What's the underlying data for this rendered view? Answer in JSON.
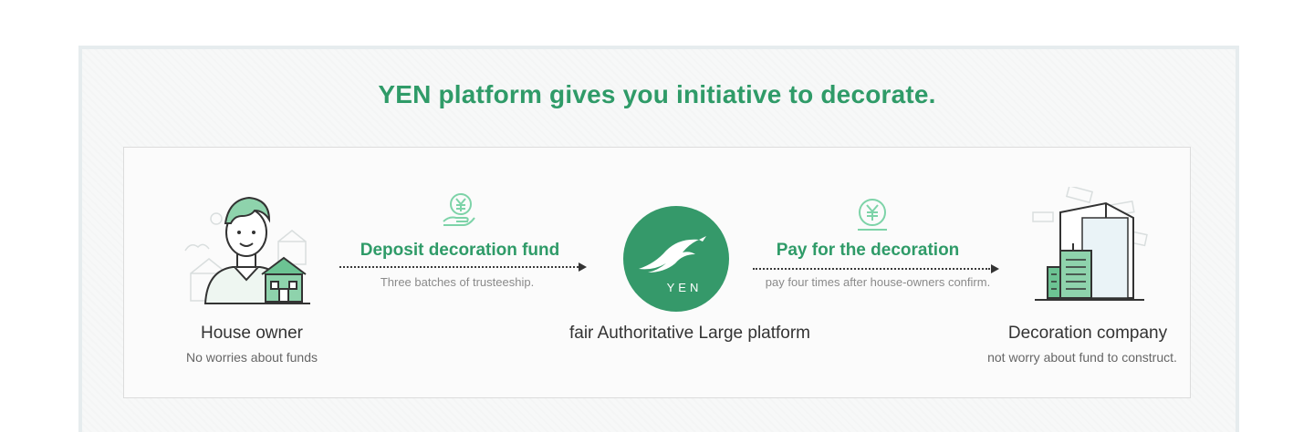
{
  "headline": "YEN platform gives you initiative to decorate.",
  "flow": {
    "house_owner": {
      "label": "House owner",
      "subtitle": "No worries about funds"
    },
    "step_deposit": {
      "title": "Deposit decoration fund",
      "subtitle": "Three batches of trusteeship.",
      "icon": "yen-hand-icon"
    },
    "platform": {
      "logo_text": "YEN",
      "label": "fair Authoritative Large platform"
    },
    "step_pay": {
      "title": "Pay for the decoration",
      "subtitle": "pay four times after house-owners confirm.",
      "icon": "yen-coin-icon"
    },
    "company": {
      "label": "Decoration company",
      "subtitle": "not worry about fund to construct."
    }
  },
  "colors": {
    "brand_green": "#2f9b68",
    "logo_green": "#35996a",
    "arrow": "#333333"
  }
}
